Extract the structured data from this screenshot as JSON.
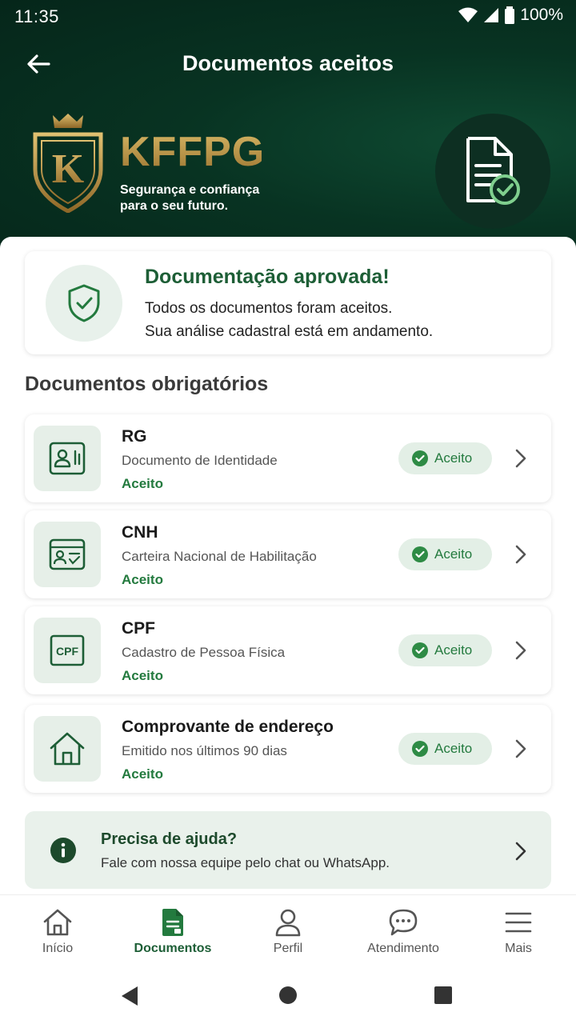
{
  "status_bar": {
    "time": "11:35",
    "battery": "100%"
  },
  "app_bar": {
    "title": "Documentos aceitos"
  },
  "brand": {
    "logo_letter": "K",
    "name": "KFFPG",
    "tagline_line1": "Segurança e confiança",
    "tagline_line2": "para o seu futuro."
  },
  "approved": {
    "title": "Documentação aprovada!",
    "line1": "Todos os documentos foram aceitos.",
    "line2": "Sua análise cadastral está em andamento."
  },
  "section_title": "Documentos obrigatórios",
  "documents": [
    {
      "name": "RG",
      "description": "Documento de Identidade",
      "status": "Aceito",
      "badge": "Aceito",
      "icon": "id-card-icon"
    },
    {
      "name": "CNH",
      "description": "Carteira Nacional de Habilitação",
      "status": "Aceito",
      "badge": "Aceito",
      "icon": "driver-license-icon"
    },
    {
      "name": "CPF",
      "description": "Cadastro de Pessoa Física",
      "status": "Aceito",
      "badge": "Aceito",
      "icon": "cpf-icon",
      "icon_text": "CPF"
    },
    {
      "name": "Comprovante de endereço",
      "description": "Emitido nos últimos 90 dias",
      "status": "Aceito",
      "badge": "Aceito",
      "icon": "house-icon"
    }
  ],
  "help": {
    "title": "Precisa de ajuda?",
    "text": "Fale com nossa equipe pelo chat ou WhatsApp."
  },
  "bottom_nav": [
    {
      "label": "Início",
      "icon": "home-icon"
    },
    {
      "label": "Documentos",
      "icon": "document-icon",
      "active": true
    },
    {
      "label": "Perfil",
      "icon": "user-icon"
    },
    {
      "label": "Atendimento",
      "icon": "chat-icon"
    },
    {
      "label": "Mais",
      "icon": "menu-icon"
    }
  ],
  "colors": {
    "primary": "#1d5e36",
    "accent_green": "#237a3e",
    "header_bg": "#05261a",
    "gold": "#b08a3c"
  }
}
